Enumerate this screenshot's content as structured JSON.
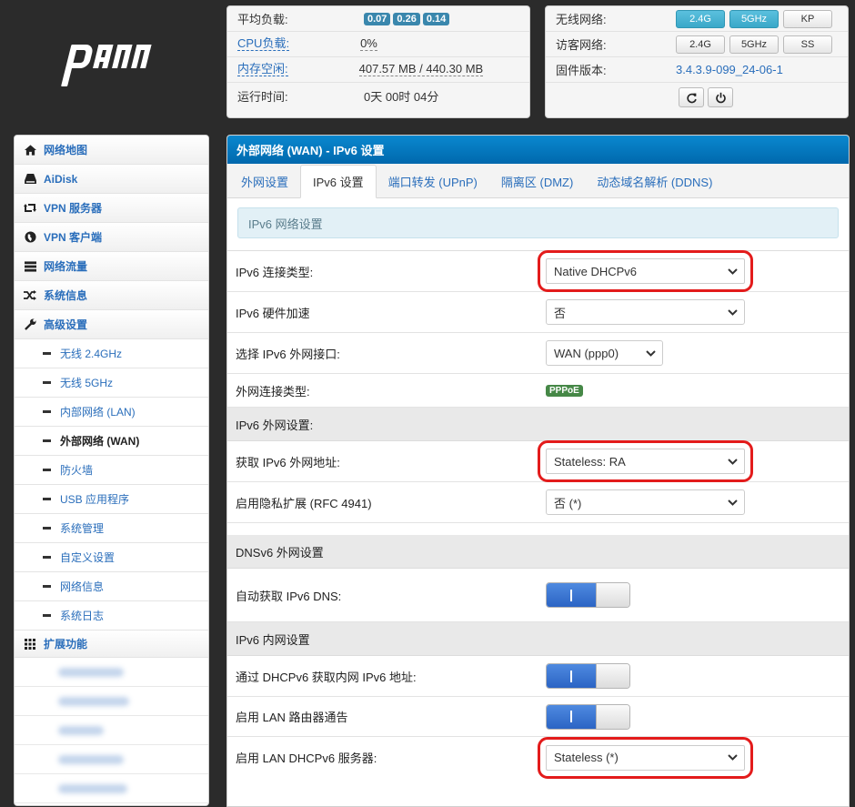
{
  "logo": {
    "text": "padavan",
    "icon": "padavan-logo"
  },
  "status": {
    "load_label": "平均负载:",
    "load_values": [
      "0.07",
      "0.26",
      "0.14"
    ],
    "cpu_label": "CPU负载:",
    "cpu_value": "0%",
    "mem_label": "内存空闲:",
    "mem_value": "407.57 MB / 440.30 MB",
    "uptime_label": "运行时间:",
    "uptime_value": "0天 00时 04分"
  },
  "wireless": {
    "wifi_label": "无线网络:",
    "wifi_buttons": [
      {
        "label": "2.4G",
        "active": true
      },
      {
        "label": "5GHz",
        "active": true
      },
      {
        "label": "KP",
        "active": false
      }
    ],
    "guest_label": "访客网络:",
    "guest_buttons": [
      {
        "label": "2.4G",
        "active": false
      },
      {
        "label": "5GHz",
        "active": false
      },
      {
        "label": "SS",
        "active": false
      }
    ],
    "fw_label": "固件版本:",
    "fw_value": "3.4.3.9-099_24-06-1",
    "icons": [
      "refresh-icon",
      "power-icon"
    ]
  },
  "sidebar": {
    "items": [
      {
        "label": "网络地图",
        "icon": "home-icon"
      },
      {
        "label": "AiDisk",
        "icon": "disk-icon"
      },
      {
        "label": "VPN 服务器",
        "icon": "retweet-icon"
      },
      {
        "label": "VPN 客户端",
        "icon": "globe-icon"
      },
      {
        "label": "网络流量",
        "icon": "list-icon"
      },
      {
        "label": "系统信息",
        "icon": "shuffle-icon"
      },
      {
        "label": "高级设置",
        "icon": "wrench-icon"
      }
    ],
    "sub_items": [
      "无线 2.4GHz",
      "无线 5GHz",
      "内部网络 (LAN)",
      "外部网络 (WAN)",
      "防火墙",
      "USB 应用程序",
      "系统管理",
      "自定义设置",
      "网络信息",
      "系统日志"
    ],
    "active_sub": "外部网络 (WAN)",
    "ext_label": "扩展功能",
    "ext_icon": "grid-icon"
  },
  "main": {
    "title": "外部网络 (WAN) - IPv6 设置",
    "tabs": [
      "外网设置",
      "IPv6 设置",
      "端口转发 (UPnP)",
      "隔离区 (DMZ)",
      "动态域名解析 (DDNS)"
    ],
    "active_tab": "IPv6 设置",
    "alert": "IPv6 网络设置",
    "conn_type_label": "IPv6 连接类型:",
    "conn_type_value": "Native DHCPv6",
    "hw_accel_label": "IPv6 硬件加速",
    "hw_accel_value": "否",
    "wan_if_label": "选择 IPv6 外网接口:",
    "wan_if_value": "WAN (ppp0)",
    "wan_type_label": "外网连接类型:",
    "wan_type_value": "PPPoE",
    "section_wan": "IPv6 外网设置:",
    "get_addr_label": "获取 IPv6 外网地址:",
    "get_addr_value": "Stateless: RA",
    "privacy_label": "启用隐私扩展 (RFC 4941)",
    "privacy_value": "否 (*)",
    "section_dns": "DNSv6 外网设置",
    "auto_dns_label": "自动获取 IPv6 DNS:",
    "section_lan": "IPv6 内网设置",
    "dhcp_lan_label": "通过 DHCPv6 获取内网 IPv6 地址:",
    "lan_ra_label": "启用 LAN 路由器通告",
    "lan_dhcp_label": "启用 LAN DHCPv6 服务器:",
    "lan_dhcp_value": "Stateless (*)",
    "toggles": {
      "auto_dns": true,
      "dhcp_lan": true,
      "lan_ra": true
    }
  },
  "colors": {
    "header_blue": "#0a88cf",
    "link_blue": "#2a6ebb",
    "highlight_red": "#e31b1b",
    "badge_green": "#468847",
    "badge_blue": "#3a87ad"
  }
}
